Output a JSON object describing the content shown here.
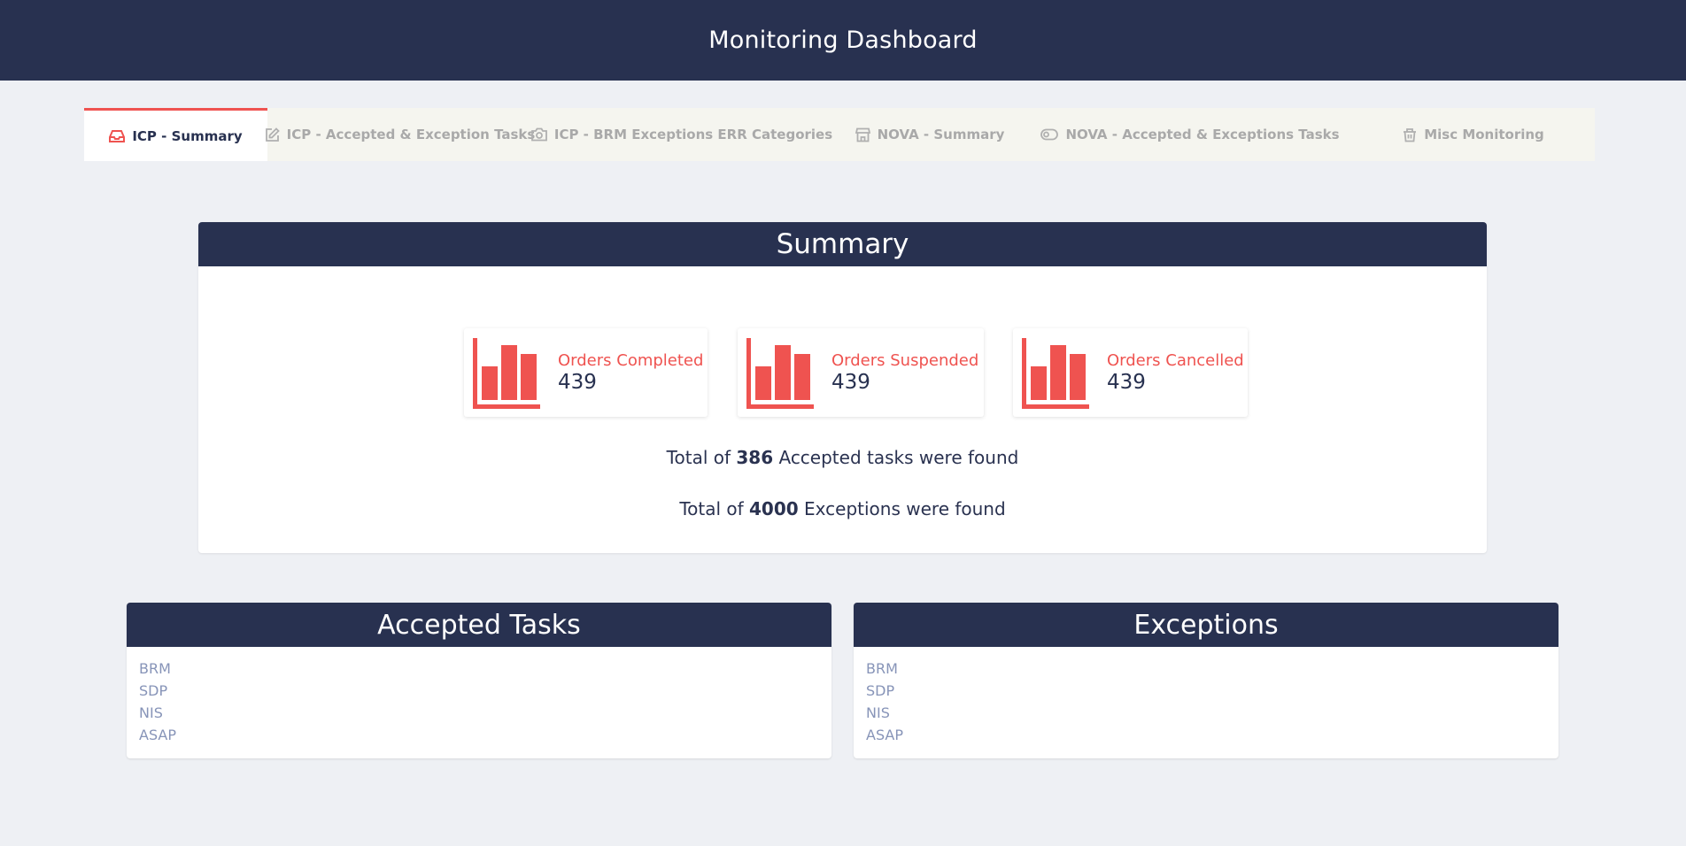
{
  "header": {
    "title": "Monitoring Dashboard"
  },
  "tabs": [
    {
      "label": "ICP - Summary",
      "icon": "inbox-icon",
      "active": true
    },
    {
      "label": "ICP - Accepted & Exception Tasks",
      "icon": "edit-icon",
      "active": false
    },
    {
      "label": "ICP - BRM Exceptions ERR Categories",
      "icon": "camera-icon",
      "active": false
    },
    {
      "label": "NOVA - Summary",
      "icon": "store-icon",
      "active": false
    },
    {
      "label": "NOVA - Accepted & Exceptions Tasks",
      "icon": "toggle-icon",
      "active": false
    },
    {
      "label": "Misc Monitoring",
      "icon": "basket-icon",
      "active": false
    }
  ],
  "summary": {
    "title": "Summary",
    "cards": [
      {
        "label": "Orders Completed",
        "value": "439",
        "icon": "bar-chart-icon"
      },
      {
        "label": "Orders Suspended",
        "value": "439",
        "icon": "bar-chart-icon"
      },
      {
        "label": "Orders Cancelled",
        "value": "439",
        "icon": "bar-chart-icon"
      }
    ],
    "accepted_line": {
      "prefix": "Total of ",
      "count": "386",
      "suffix": " Accepted tasks were found"
    },
    "exceptions_line": {
      "prefix": "Total of ",
      "count": "4000",
      "suffix": " Exceptions were found"
    }
  },
  "accepted_tasks": {
    "title": "Accepted Tasks",
    "items": [
      "BRM",
      "SDP",
      "NIS",
      "ASAP"
    ]
  },
  "exceptions": {
    "title": "Exceptions",
    "items": [
      "BRM",
      "SDP",
      "NIS",
      "ASAP"
    ]
  },
  "colors": {
    "navy": "#283150",
    "accent": "#ef5350",
    "background": "#eef0f4",
    "link": "#8794b8"
  }
}
